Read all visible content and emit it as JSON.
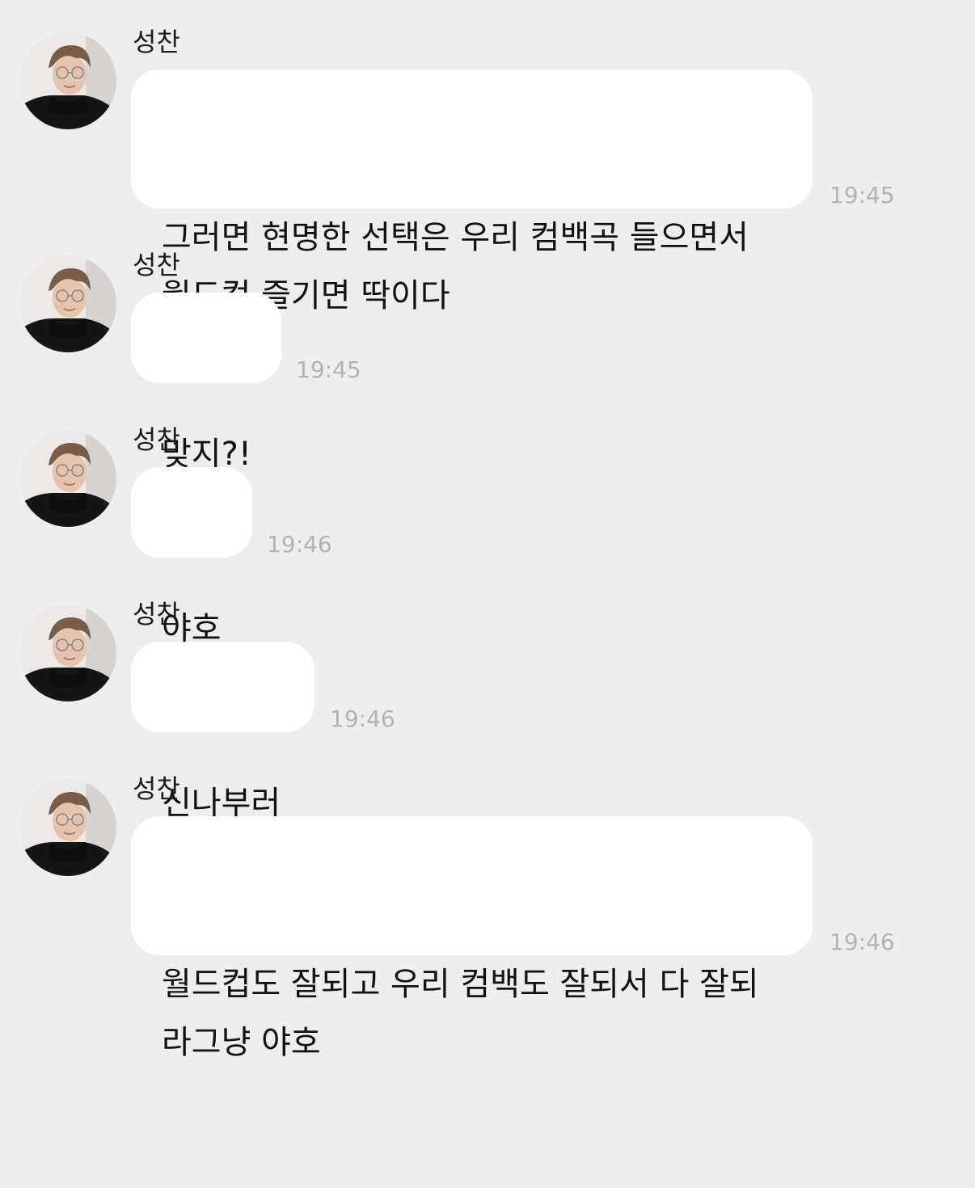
{
  "messages": [
    {
      "sender": "성찬",
      "text": "그러면 현명한 선택은 우리 컴백곡 들으면서\n월드컵 즐기면 딱이다",
      "time": "19:45"
    },
    {
      "sender": "성찬",
      "text": "맞지?!",
      "time": "19:45"
    },
    {
      "sender": "성찬",
      "text": "야호",
      "time": "19:46"
    },
    {
      "sender": "성찬",
      "text": "신나부러",
      "time": "19:46"
    },
    {
      "sender": "성찬",
      "text": "월드컵도 잘되고 우리 컴백도 잘되서 다 잘되\n라그냥 야호",
      "time": "19:46"
    }
  ],
  "colors": {
    "background": "#eeeeee",
    "bubble": "#ffffff",
    "message_text": "#111111",
    "sender_text": "#1c1c1c",
    "time_text": "#b3b3b3"
  },
  "icons": {
    "avatar": "profile-photo"
  }
}
